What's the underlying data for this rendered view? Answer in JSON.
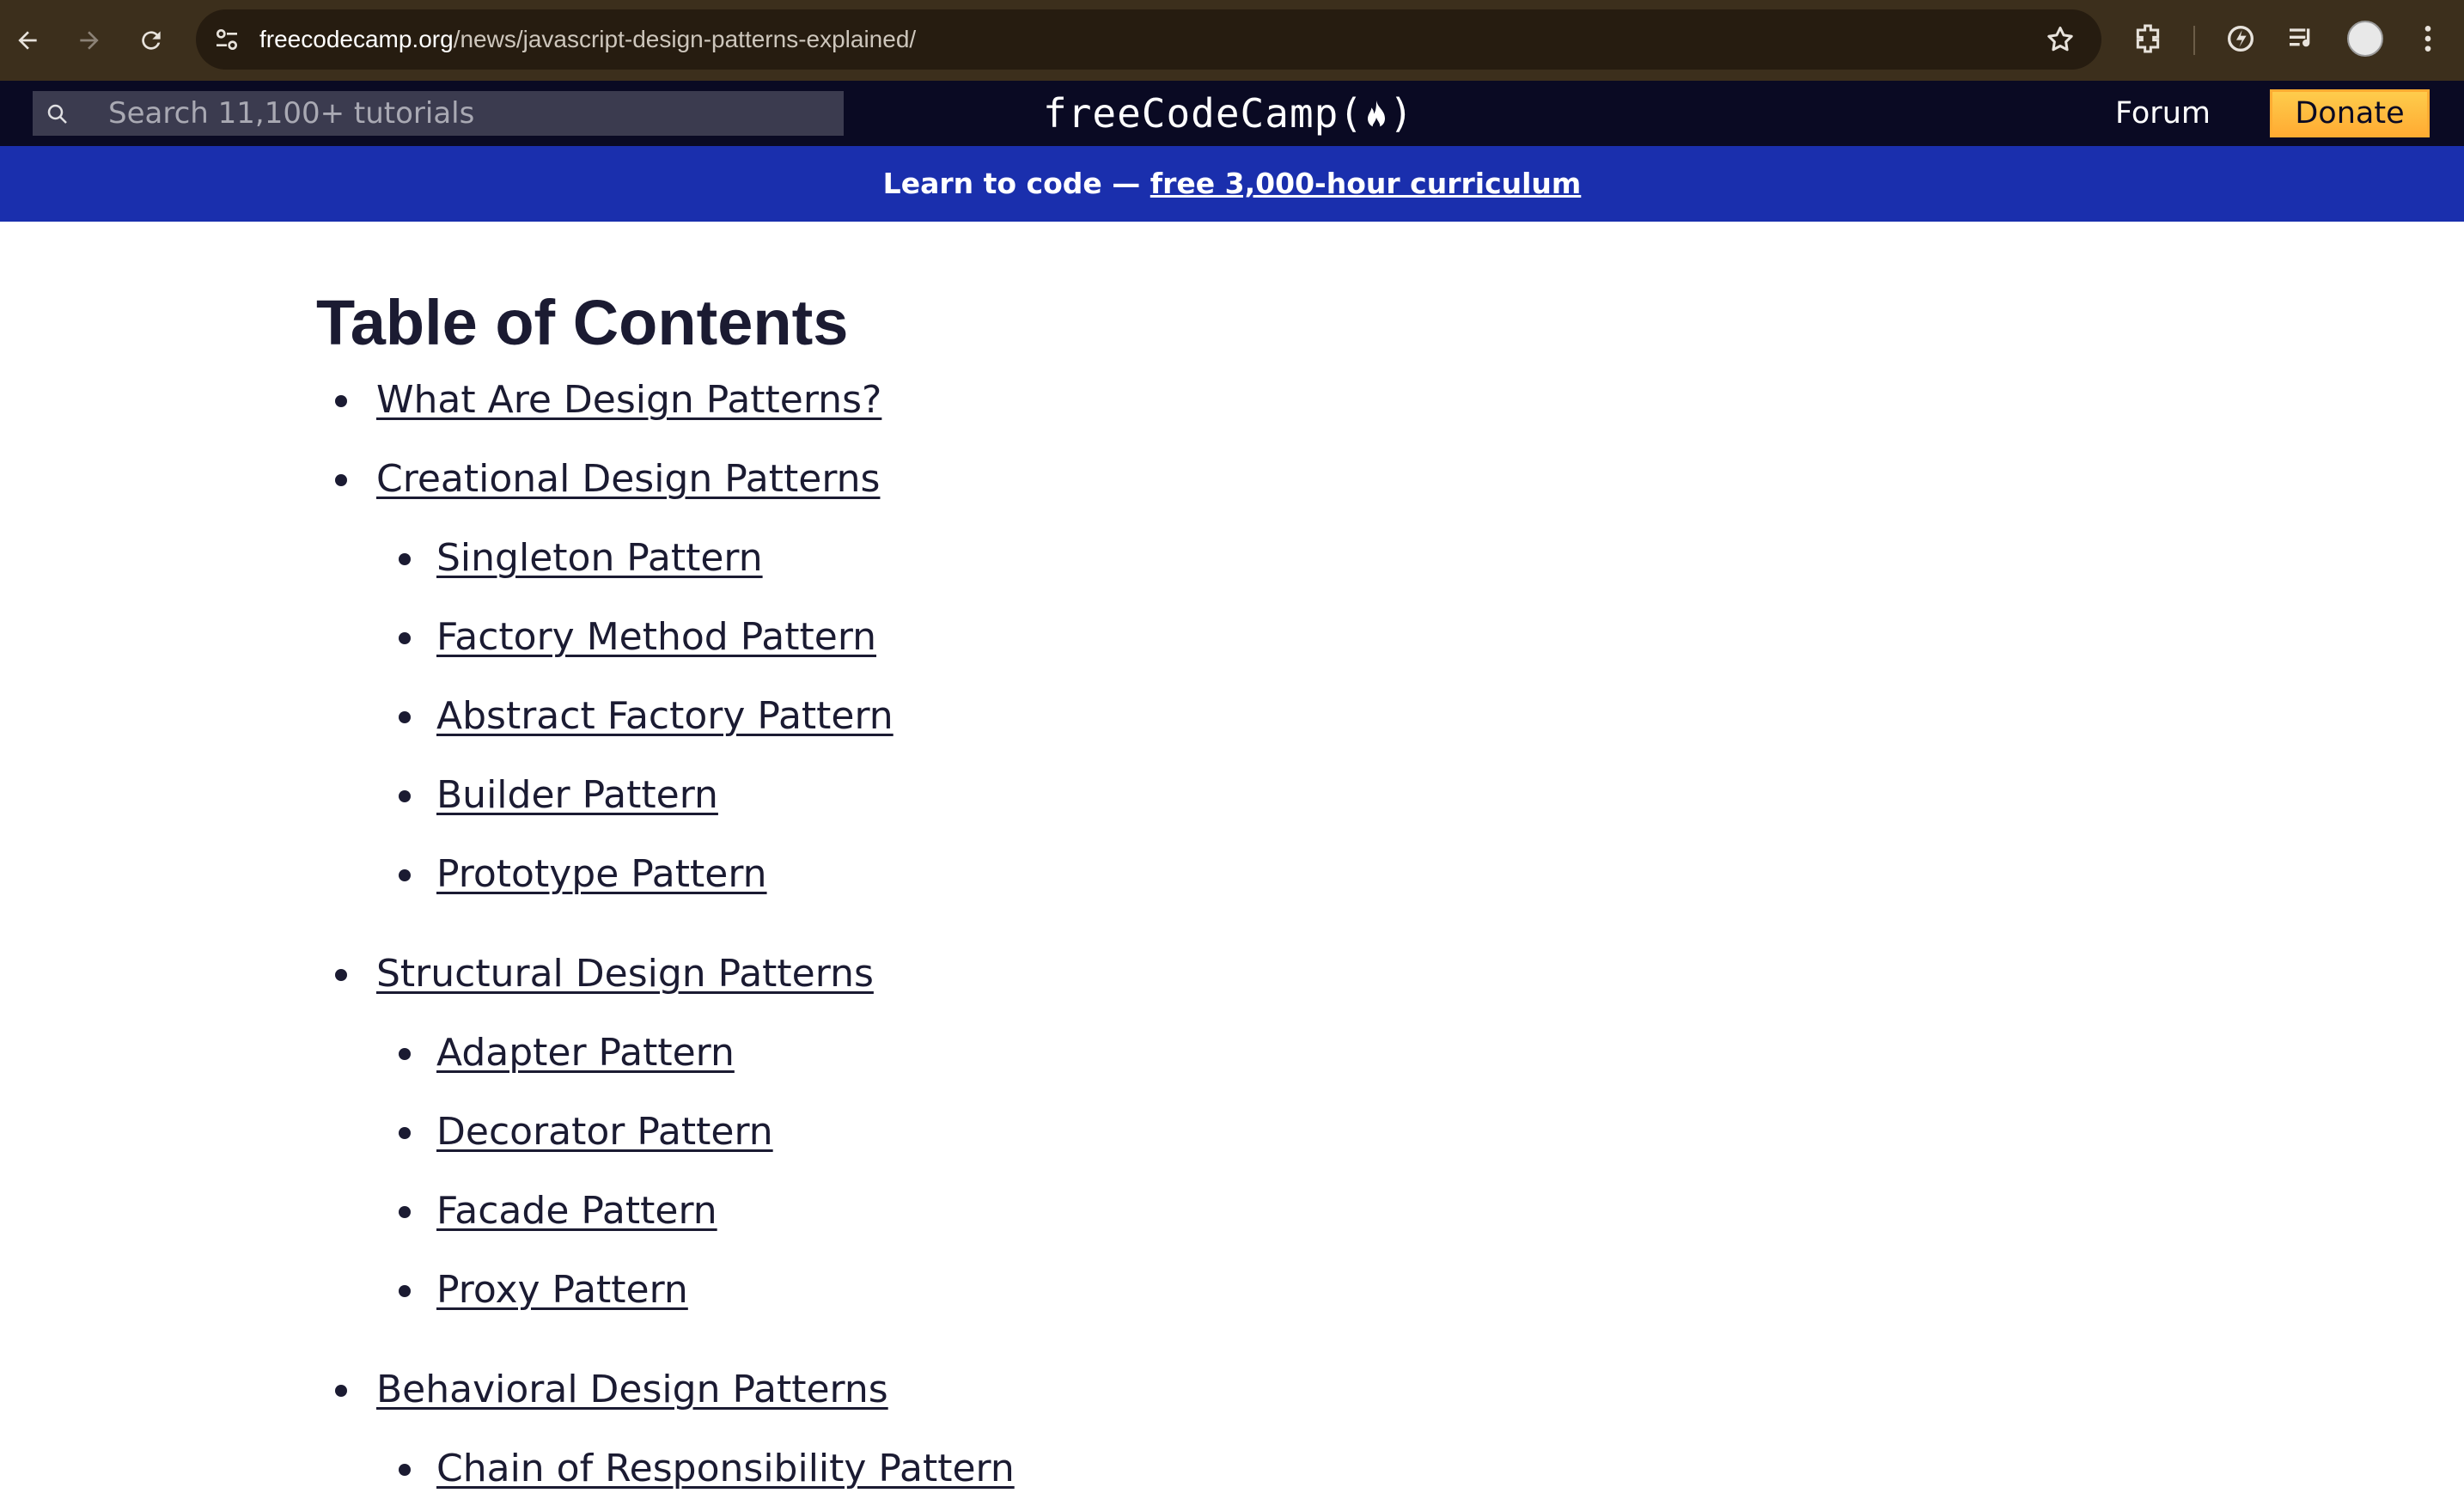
{
  "browser": {
    "url_domain": "freecodecamp.org",
    "url_path": "/news/javascript-design-patterns-explained/"
  },
  "nav": {
    "search_placeholder": "Search 11,100+ tutorials",
    "logo_text": "freeCodeCamp",
    "forum_label": "Forum",
    "donate_label": "Donate"
  },
  "banner": {
    "text": "Learn to code — ",
    "link": "free 3,000-hour curriculum"
  },
  "toc": {
    "title": "Table of Contents",
    "items": [
      {
        "label": "What Are Design Patterns?",
        "level": 1
      },
      {
        "label": "Creational Design Patterns",
        "level": 1
      },
      {
        "label": "Singleton Pattern",
        "level": 2
      },
      {
        "label": "Factory Method Pattern",
        "level": 2
      },
      {
        "label": "Abstract Factory Pattern",
        "level": 2
      },
      {
        "label": "Builder Pattern",
        "level": 2
      },
      {
        "label": "Prototype Pattern",
        "level": 2
      },
      {
        "label": "Structural Design Patterns",
        "level": 1
      },
      {
        "label": "Adapter Pattern",
        "level": 2
      },
      {
        "label": "Decorator Pattern",
        "level": 2
      },
      {
        "label": "Facade Pattern",
        "level": 2
      },
      {
        "label": "Proxy Pattern",
        "level": 2
      },
      {
        "label": "Behavioral Design Patterns",
        "level": 1
      },
      {
        "label": "Chain of Responsibility Pattern",
        "level": 2
      }
    ]
  },
  "colors": {
    "chrome_bg": "#3c2f1c",
    "nav_bg": "#0a0a23",
    "banner_bg": "#1a2fad",
    "donate_bg": "#feac32",
    "text": "#1b1b32"
  }
}
